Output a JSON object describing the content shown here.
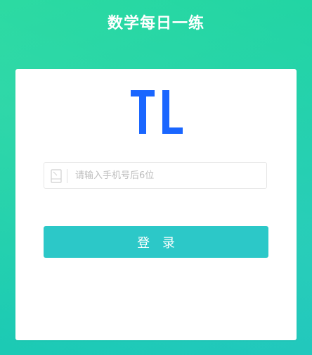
{
  "app": {
    "title": "数学每日一练"
  },
  "login": {
    "logo_icon": "ti-logo-icon",
    "brand_color": "#1a66ff",
    "phone_field": {
      "icon": "phone-icon",
      "placeholder": "请输入手机号后6位",
      "value": ""
    },
    "submit_label": "登 录",
    "button_color": "#2cc8c8"
  },
  "background": {
    "gradient_start": "#25d99f",
    "gradient_end": "#1ac6bb"
  }
}
